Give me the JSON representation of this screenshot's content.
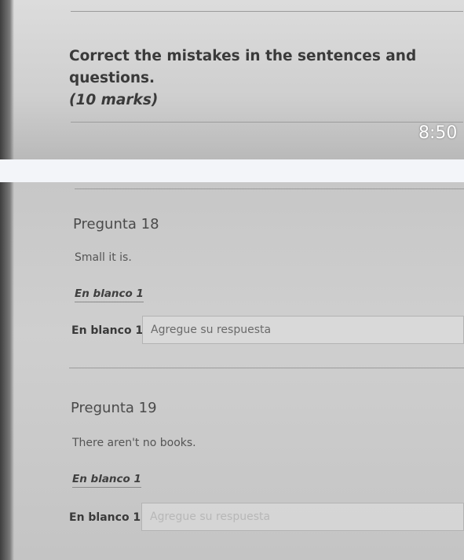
{
  "instructions": {
    "line1": "Correct the mistakes in the sentences and questions.",
    "marks": "(10 marks)"
  },
  "status": {
    "time": "8:50"
  },
  "questions": [
    {
      "title": "Pregunta 18",
      "sentence": "Small it is.",
      "blank_heading": "En blanco 1",
      "field_label": "En blanco 1",
      "placeholder": "Agregue su respuesta"
    },
    {
      "title": "Pregunta 19",
      "sentence": "There aren't no books.",
      "blank_heading": "En blanco 1",
      "field_label": "En blanco 1",
      "placeholder": "Agregue su respuesta"
    }
  ]
}
